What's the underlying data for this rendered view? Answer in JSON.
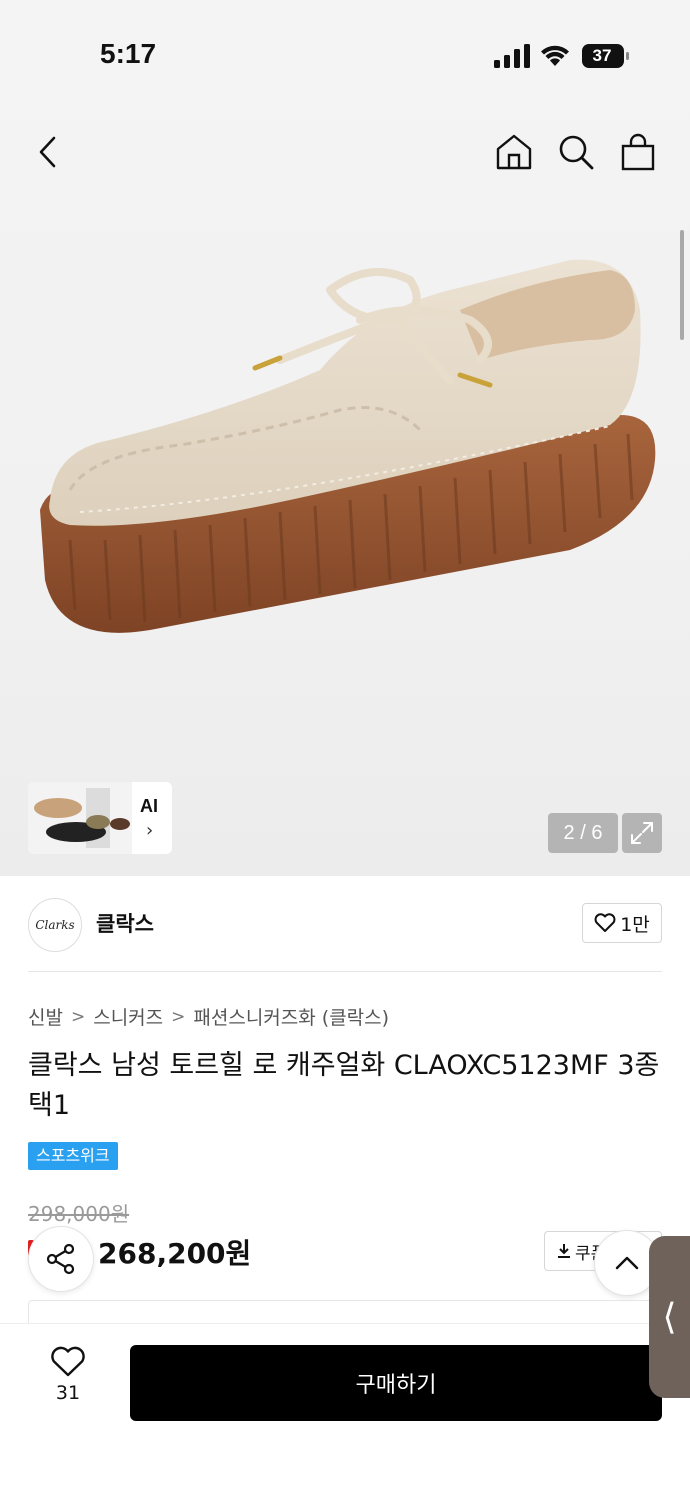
{
  "status_bar": {
    "time": "5:17",
    "battery": "37"
  },
  "gallery": {
    "counter": "2 / 6",
    "ai_label": "AI",
    "ai_chevron": "›"
  },
  "brand": {
    "logo_text": "Clarks",
    "name": "클락스",
    "like_count": "1만"
  },
  "breadcrumb": [
    "신발",
    "스니커즈",
    "패션스니커즈화 (클락스)"
  ],
  "product": {
    "title": "클락스 남성 토르힐 로 캐주얼화 CLAOXC5123MF 3종 택1",
    "badge": "스포츠위크",
    "original_price": "298,000원",
    "sale_price": "268,200원",
    "coupon_label": "쿠폰"
  },
  "side_handle": "⟨",
  "bottom_bar": {
    "wish_count": "31",
    "buy_label": "구매하기"
  },
  "colors": {
    "badge": "#2aa1f0",
    "buy_button": "#000000",
    "discount": "#e02020"
  }
}
